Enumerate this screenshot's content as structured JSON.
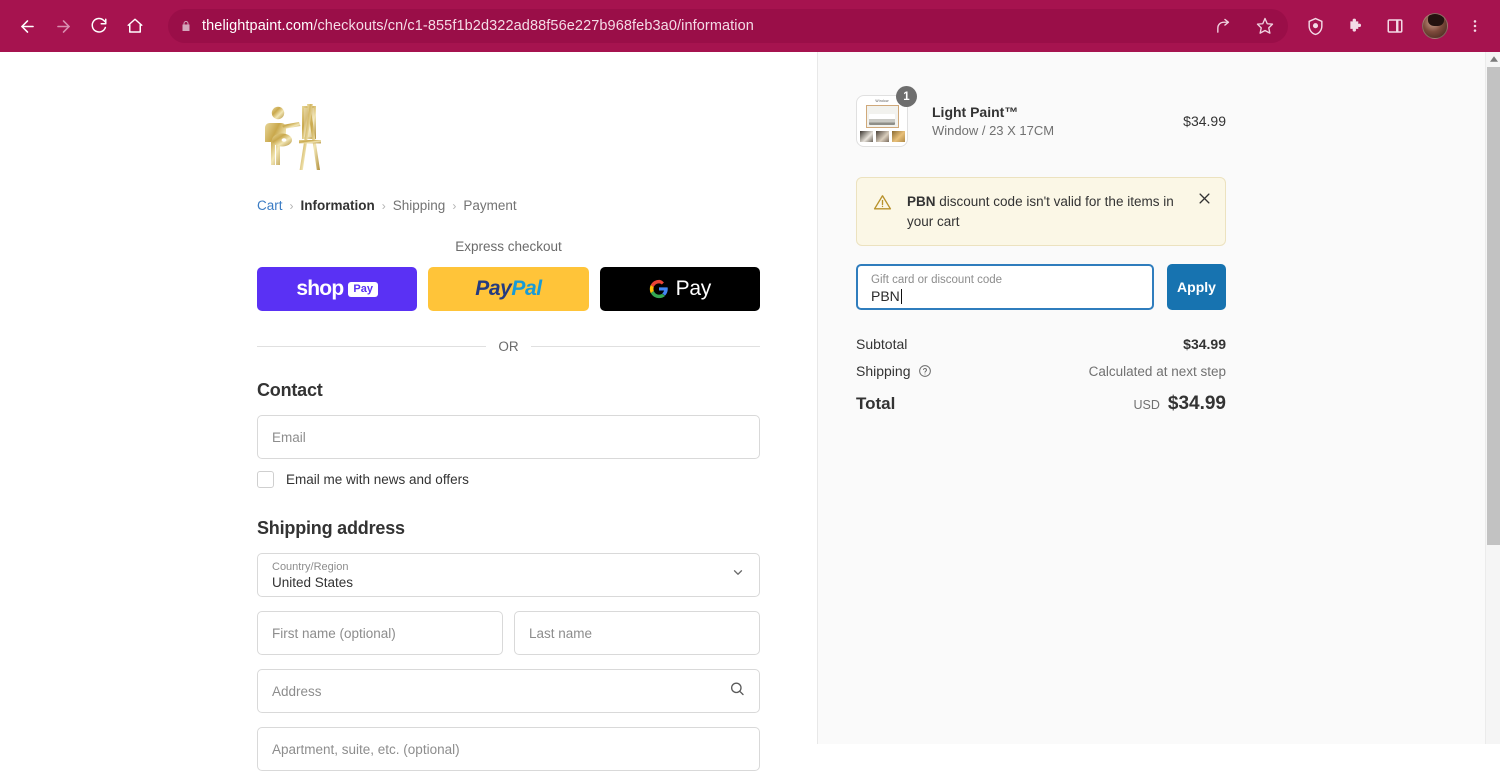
{
  "browser": {
    "back_icon": "back-arrow-icon",
    "forward_icon": "forward-arrow-icon",
    "reload_icon": "reload-icon",
    "home_icon": "home-icon",
    "lock_icon": "lock-icon",
    "url_domain": "thelightpaint.com",
    "url_path": "/checkouts/cn/c1-855f1b2d322ad88f56e227b968feb3a0/information",
    "url_full": "thelightpaint.com/checkouts/cn/c1-855f1b2d322ad88f56e227b968feb3a0/information",
    "icons": [
      "share-icon",
      "bookmark-star-icon",
      "shield-icon",
      "extensions-puzzle-icon",
      "side-panel-icon",
      "avatar",
      "three-dot-menu-icon"
    ],
    "chrome_color": "#a6134f",
    "url_bar_color": "#9a0e48"
  },
  "checkout": {
    "logo_alt": "painter-easel-logo",
    "breadcrumb": [
      {
        "label": "Cart",
        "state": "link"
      },
      {
        "label": "Information",
        "state": "current"
      },
      {
        "label": "Shipping",
        "state": "upcoming"
      },
      {
        "label": "Payment",
        "state": "upcoming"
      }
    ],
    "breadcrumb_separator": "›",
    "express": {
      "heading": "Express checkout",
      "shop_pay": {
        "word": "shop",
        "pill": "Pay",
        "color": "#5a31f4"
      },
      "paypal": {
        "part1": "Pay",
        "part2": "Pal",
        "color": "#ffc439"
      },
      "gpay": {
        "label": "Pay",
        "color": "#000000"
      }
    },
    "or_text": "OR",
    "contact": {
      "title": "Contact",
      "email_placeholder": "Email",
      "newsletter_label": "Email me with news and offers",
      "newsletter_checked": false
    },
    "shipping_address": {
      "title": "Shipping address",
      "country_label": "Country/Region",
      "country_value": "United States",
      "first_name_placeholder": "First name (optional)",
      "last_name_placeholder": "Last name",
      "address_placeholder": "Address",
      "apartment_placeholder": "Apartment, suite, etc. (optional)"
    }
  },
  "summary": {
    "product": {
      "title": "Light Paint™",
      "variant": "Window / 23 X 17CM",
      "price": "$34.99",
      "quantity": "1",
      "thumb_caption": "Window"
    },
    "alert": {
      "code": "PBN",
      "message": " discount code isn't valid for the items in your cart",
      "icon": "warning-triangle-icon",
      "close_icon": "close-icon",
      "background": "#fbf7e6"
    },
    "discount": {
      "label": "Gift card or discount code",
      "value": "PBN",
      "apply_label": "Apply",
      "apply_color": "#1773b0",
      "focus_color": "#2f7dbd"
    },
    "totals": {
      "subtotal_label": "Subtotal",
      "subtotal_value": "$34.99",
      "shipping_label": "Shipping",
      "shipping_info_icon": "question-circle-icon",
      "shipping_value": "Calculated at next step",
      "total_label": "Total",
      "total_currency": "USD",
      "total_value": "$34.99"
    }
  }
}
